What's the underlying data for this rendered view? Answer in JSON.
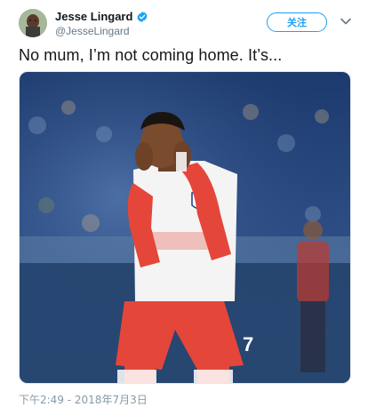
{
  "tweet": {
    "author_name": "Jesse Lingard",
    "author_handle": "@JesseLingard",
    "follow_label": "关注",
    "text": "No mum, I’m not coming home. It’s...",
    "timestamp": "下午2:49 - 2018年7月3日",
    "media": {
      "description_icon": "photo",
      "shirt_number": "7"
    }
  },
  "colors": {
    "accent": "#1da1f2",
    "secondary_text": "#657786",
    "border": "#e1e8ed"
  }
}
